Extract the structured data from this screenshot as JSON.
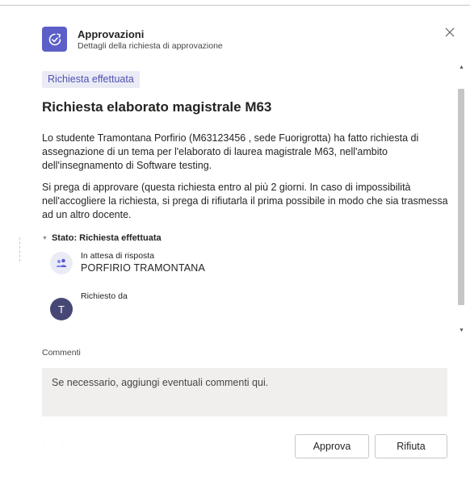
{
  "header": {
    "app_title": "Approvazioni",
    "app_subtitle": "Dettagli della richiesta di approvazione",
    "icon": "approvals-icon",
    "accent_color": "#5b5fc7"
  },
  "request": {
    "status_pill": "Richiesta effettuata",
    "title": "Richiesta elaborato magistrale M63",
    "paragraph1": "Lo studente Tramontana Porfirio (M63123456 , sede Fuorigrotta) ha fatto richiesta di assegnazione di un tema per l'elaborato di laurea magistrale M63, nell'ambito dell'insegnamento di Software testing.",
    "paragraph2": "Si prega di approvare (questa richiesta entro al più 2 giorni. In caso di impossibilità nell'accogliere la richiesta, si prega di rifiutarla il prima possibile in modo che sia trasmessa ad un altro docente."
  },
  "status": {
    "label": "Stato: Richiesta effettuata",
    "steps": [
      {
        "label": "In attesa di risposta",
        "value": "PORFIRIO TRAMONTANA",
        "icon": "people-icon"
      },
      {
        "label": "Richiesto da",
        "avatar_initial": "T"
      }
    ]
  },
  "comments": {
    "label": "Commenti",
    "placeholder": "Se necessario, aggiungi eventuali commenti qui."
  },
  "actions": {
    "approve_label": "Approva",
    "reject_label": "Rifiuta"
  }
}
